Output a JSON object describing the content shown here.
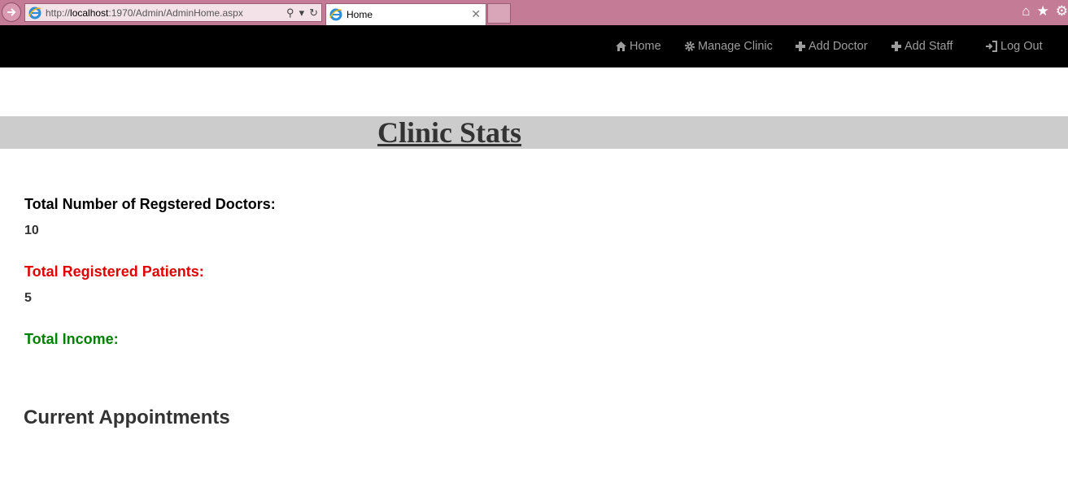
{
  "browser": {
    "url_prefix": "http://",
    "url_host": "localhost",
    "url_rest": ":1970/Admin/AdminHome.aspx",
    "tab_title": "Home",
    "chrome_color": "#c47b96"
  },
  "navbar": {
    "items": [
      {
        "label": "Home",
        "icon": "home-icon"
      },
      {
        "label": "Manage Clinic",
        "icon": "gear-icon"
      },
      {
        "label": "Add Doctor",
        "icon": "plus-icon"
      },
      {
        "label": "Add Staff",
        "icon": "plus-icon"
      },
      {
        "label": "Log Out",
        "icon": "log-out-icon"
      }
    ]
  },
  "page": {
    "title": "Clinic Stats",
    "stats": [
      {
        "label": "Total Number of Regstered Doctors:",
        "value": "10",
        "color": "#000000"
      },
      {
        "label": "Total Registered Patients:",
        "value": "5",
        "color": "#e00000"
      },
      {
        "label": "Total Income:",
        "value": "",
        "color": "#008000"
      }
    ],
    "appointments_title": "Current Appointments"
  }
}
